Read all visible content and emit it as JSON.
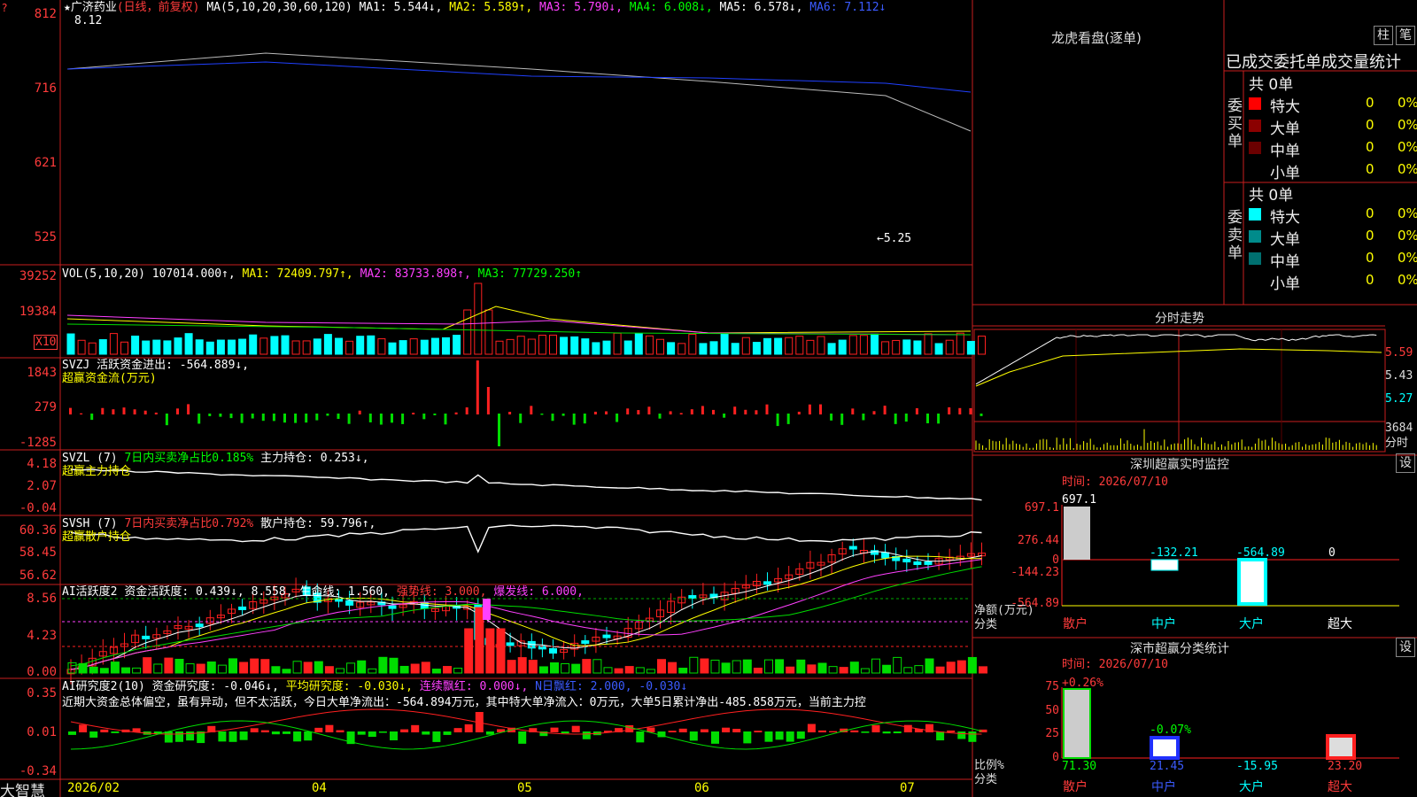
{
  "header": {
    "stock_name": "广济药业",
    "mode": "(日线，前复权)",
    "ma_label": "MA(5,10,20,30,60,120)",
    "ma1": "MA1: 5.544↓,",
    "ma2": "MA2: 5.589↑,",
    "ma3": "MA3: 5.790↓,",
    "ma4": "MA4: 6.008↓,",
    "ma5": "MA5: 6.578↓,",
    "ma6": "MA6: 7.112↓",
    "high_mark": "8.12",
    "low_mark": "←5.25"
  },
  "price_axis": [
    "812",
    "716",
    "621",
    "525"
  ],
  "vol": {
    "label": "VOL(5,10,20)",
    "value": "107014.000↑,",
    "ma1": "MA1: 72409.797↑,",
    "ma2": "MA2: 83733.898↑,",
    "ma3": "MA3: 77729.250↑",
    "axis": [
      "39252",
      "19384"
    ],
    "unit": "X10"
  },
  "svzj": {
    "label": "SVZJ  活跃资金进出: -564.889↓,",
    "sub": "超赢资金流(万元)",
    "axis": [
      "1843",
      "279",
      "-1285"
    ]
  },
  "svzl": {
    "label": "SVZL (7)",
    "ratio": "7日内买卖净占比0.185%",
    "hold": "主力持仓: 0.253↓,",
    "sub": "超赢主力持仓",
    "axis": [
      "4.18",
      "2.07",
      "-0.04"
    ]
  },
  "svsh": {
    "label": "SVSH (7)",
    "ratio": "7日内买卖净占比0.792%",
    "hold": "散户持仓: 59.796↑,",
    "sub": "超赢散户持仓",
    "axis": [
      "60.36",
      "58.45",
      "56.62"
    ]
  },
  "ai_active": {
    "label": "AI活跃度2",
    "value": "资金活跃度: 0.439↓, 8.558,",
    "life": "生命线: 1.560,",
    "strong": "强势线: 3.000,",
    "burst": "爆发线: 6.000,",
    "axis": [
      "8.56",
      "4.23",
      "0.00"
    ]
  },
  "ai_research": {
    "label": "AI研究度2(10)",
    "value": "资金研究度: -0.046↓,",
    "avg": "平均研究度: -0.030↓,",
    "cont": "连续飘红: 0.000↓,",
    "nday": "N日飘红: 2.000, -0.030↓",
    "comment": "近期大资金总体偏空，虽有异动，但不太活跃，今日大单净流出：-564.894万元，其中特大单净流入：0万元，大单5日累计净出-485.858万元，当前主力控",
    "axis": [
      "0.35",
      "0.01",
      "-0.34"
    ]
  },
  "time_axis": [
    "2026/02",
    "04",
    "05",
    "06",
    "07"
  ],
  "brand": "大智慧",
  "right": {
    "dragon_title": "龙虎看盘(逐单)",
    "btn_zhu": "柱",
    "btn_bi": "笔",
    "stats_title": "已成交委托单成交量统计",
    "buy_label": "委买单",
    "sell_label": "委卖单",
    "buy_total": "共 0单",
    "sell_total": "共 0单",
    "buy_rows": [
      {
        "name": "特大",
        "count": "0",
        "pct": "0%",
        "color": "#ff0000"
      },
      {
        "name": "大单",
        "count": "0",
        "pct": "0%",
        "color": "#8b0000"
      },
      {
        "name": "中单",
        "count": "0",
        "pct": "0%",
        "color": "#6b0000"
      },
      {
        "name": "小单",
        "count": "0",
        "pct": "0%",
        "color": "#000000"
      }
    ],
    "sell_rows": [
      {
        "name": "特大",
        "count": "0",
        "pct": "0%",
        "color": "#00ffff"
      },
      {
        "name": "大单",
        "count": "0",
        "pct": "0%",
        "color": "#008b8b"
      },
      {
        "name": "中单",
        "count": "0",
        "pct": "0%",
        "color": "#007070"
      },
      {
        "name": "小单",
        "count": "0",
        "pct": "0%",
        "color": "#000000"
      }
    ],
    "intraday_title": "分时走势",
    "intraday_axis": [
      "5.59",
      "5.43",
      "5.27"
    ],
    "intraday_vol": "3684",
    "intraday_vol_unit": "分时",
    "sz_monitor_title": "深圳超赢实时监控",
    "btn_set1": "设",
    "sz_time": "时间: 2026/07/10",
    "sz_axis": [
      "697.1",
      "276.44",
      "0",
      "-144.23",
      "-564.89"
    ],
    "sz_unit": "净额(万元)",
    "sz_cat_label": "分类",
    "sz_values": [
      "697.1",
      "-132.21",
      "-564.89",
      "0"
    ],
    "cats": [
      "散户",
      "中户",
      "大户",
      "超大"
    ],
    "sm_title": "深市超赢分类统计",
    "btn_set2": "设",
    "sm_time": "时间: 2026/07/10",
    "sm_axis": [
      "75",
      "50",
      "25",
      "0"
    ],
    "sm_top": [
      "+0.26%",
      "-0.07%"
    ],
    "sm_values": [
      "71.30",
      "21.45",
      "-15.95",
      "23.20"
    ],
    "sm_unit": "比例%",
    "sm_cat_label": "分类"
  }
}
